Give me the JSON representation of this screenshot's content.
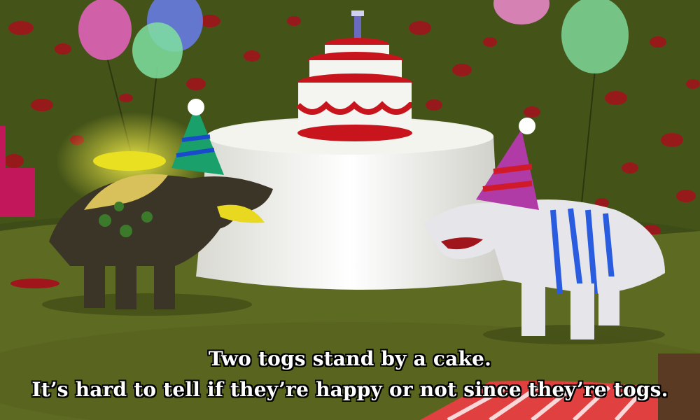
{
  "scene": {
    "caption_line_1": "Two togs stand by a cake.",
    "caption_line_2": "It’s hard to tell if they’re happy or not since they’re togs."
  },
  "colors": {
    "grass": "#5d6a22",
    "foliage": "#3f4d18",
    "leaf_dots": "#a0141c",
    "tablecloth": "#f2f2ec",
    "cake_frosting": "#c8141c",
    "left_tog_hat": "#1aa06a",
    "right_tog_hat": "#b03aa6",
    "right_tog_stripes": "#2a5ce0"
  },
  "icons": {
    "balloon_left": "balloon-icon",
    "balloon_right": "balloon-icon",
    "cake": "cake-icon",
    "left_creature": "tog-creature-icon",
    "right_creature": "tog-creature-icon"
  }
}
